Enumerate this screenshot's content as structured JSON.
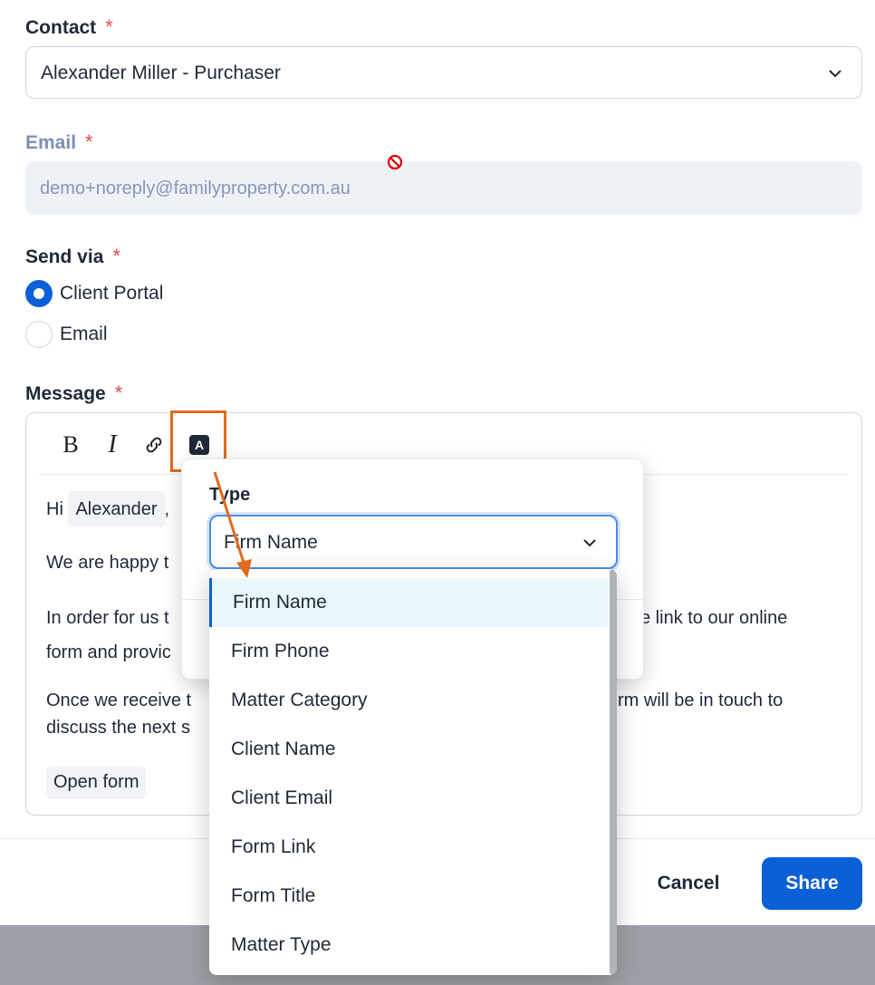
{
  "contact": {
    "label": "Contact",
    "required_mark": "*",
    "value": "Alexander Miller - Purchaser"
  },
  "email": {
    "label": "Email",
    "required_mark": "*",
    "value": "demo+noreply@familyproperty.com.au"
  },
  "send_via": {
    "label": "Send via",
    "required_mark": "*",
    "options": [
      {
        "label": "Client Portal",
        "checked": true
      },
      {
        "label": "Email",
        "checked": false
      }
    ]
  },
  "message": {
    "label": "Message",
    "required_mark": "*",
    "toolbar": {
      "bold": "B",
      "italic": "I",
      "variable": "A"
    },
    "greeting": "Hi",
    "name_chip": "Alexander",
    "greeting_comma": ",",
    "line1": "We are happy t",
    "line2_start": "In order for us t",
    "line2_end": "e link to our online",
    "line3_start": "form and provic",
    "line4_start": "Once we receive t",
    "line4_end": "rm will be in touch to",
    "line5_start": "discuss the next s",
    "open_form": "Open form"
  },
  "footer": {
    "cancel": "Cancel",
    "share": "Share"
  },
  "variable_popover": {
    "title": "Type",
    "selected": "Firm Name",
    "options": [
      "Firm Name",
      "Firm Phone",
      "Matter Category",
      "Client Name",
      "Client Email",
      "Form Link",
      "Form Title",
      "Matter Type"
    ]
  },
  "colors": {
    "accent": "#0b5fd7",
    "required": "#e5484d",
    "annotation": "#e06a1f"
  }
}
